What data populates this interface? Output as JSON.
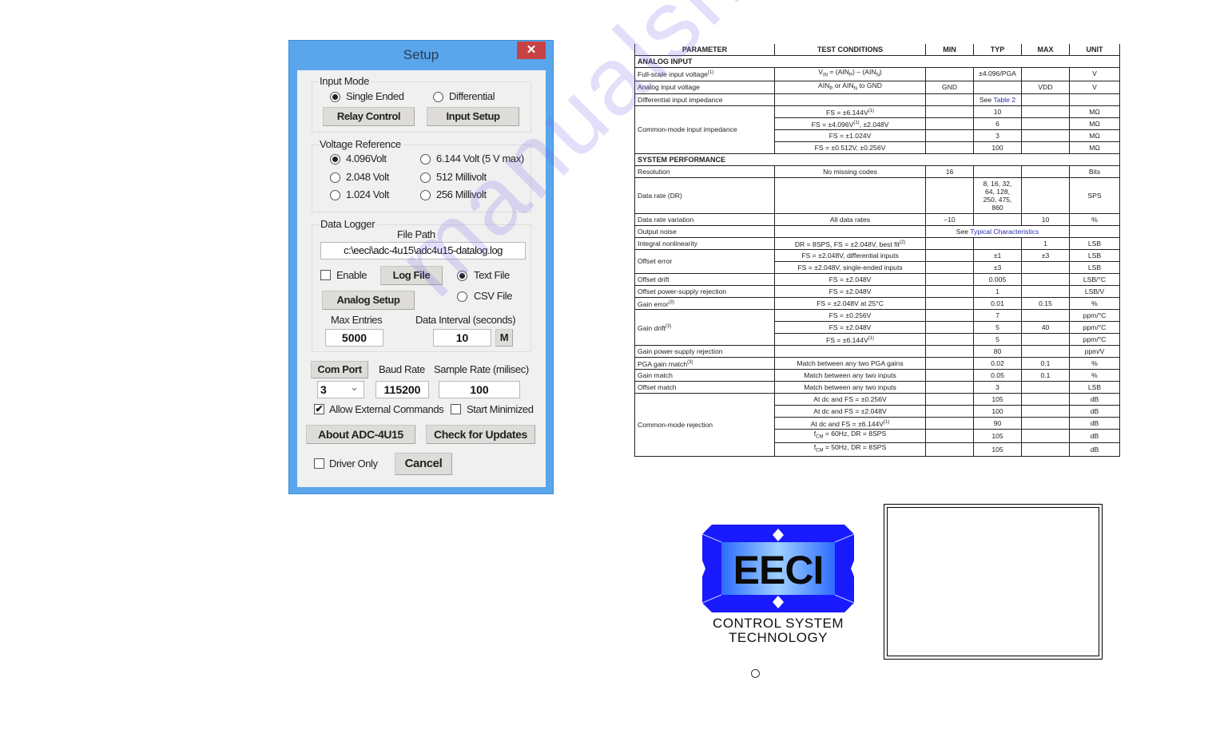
{
  "dialog": {
    "title": "Setup",
    "close_glyph": "✕",
    "input_mode": {
      "label": "Input Mode",
      "options": [
        {
          "label": "Single Ended",
          "selected": true
        },
        {
          "label": "Differential",
          "selected": false
        }
      ],
      "relay_button": "Relay Control",
      "input_setup_button": "Input Setup"
    },
    "voltage_reference": {
      "label": "Voltage Reference",
      "options": [
        {
          "label": "4.096Volt",
          "selected": true
        },
        {
          "label": "6.144 Volt (5 V max)",
          "selected": false
        },
        {
          "label": "2.048 Volt",
          "selected": false
        },
        {
          "label": "512 Millivolt",
          "selected": false
        },
        {
          "label": "1.024 Volt",
          "selected": false
        },
        {
          "label": "256 Millivolt",
          "selected": false
        }
      ]
    },
    "data_logger": {
      "label": "Data Logger",
      "file_path_label": "File Path",
      "file_path": "c:\\eeci\\adc-4u15\\adc4u15-datalog.log",
      "enable_label": "Enable",
      "enable_checked": false,
      "log_file_button": "Log File",
      "text_file_label": "Text File",
      "text_file_selected": true,
      "csv_file_label": "CSV File",
      "csv_file_selected": false,
      "analog_setup_button": "Analog Setup",
      "max_entries_label": "Max Entries",
      "max_entries": "5000",
      "data_interval_label": "Data Interval (seconds)",
      "data_interval": "10",
      "m_button": "M"
    },
    "com_port_button": "Com Port",
    "com_port_value": "3",
    "baud_rate_label": "Baud Rate",
    "baud_rate": "115200",
    "sample_rate_label": "Sample Rate (milisec)",
    "sample_rate": "100",
    "allow_external_label": "Allow External Commands",
    "allow_external_checked": true,
    "start_minimized_label": "Start Minimized",
    "start_minimized_checked": false,
    "about_button": "About ADC-4U15",
    "updates_button": "Check for Updates",
    "driver_only_label": "Driver Only",
    "driver_only_checked": false,
    "cancel_button": "Cancel",
    "check_glyph": "✔",
    "dropdown_glyph": "⌄"
  },
  "spec_table": {
    "headers": [
      "PARAMETER",
      "TEST CONDITIONS",
      "MIN",
      "TYP",
      "MAX",
      "UNIT"
    ],
    "sections": {
      "analog_input": "ANALOG INPUT",
      "system_performance": "SYSTEM PERFORMANCE"
    },
    "rows": {
      "fs_input": {
        "param": "Full-scale input voltage",
        "sup": "(1)",
        "cond": "V<sub>IN</sub> = (AIN<sub>P</sub>) – (AIN<sub>N</sub>)",
        "typ": "±4.096/PGA",
        "unit": "V"
      },
      "analog_input_v": {
        "param": "Analog input voltage",
        "cond": "AIN<sub>P</sub> or AIN<sub>N</sub> to GND",
        "min": "GND",
        "max": "VDD",
        "unit": "V"
      },
      "diff_imp": {
        "param": "Differential input impedance",
        "typ_prefix": "See ",
        "typ_link": "Table 2"
      },
      "cm_imp": {
        "param": "Common-mode input impedance",
        "subrows": [
          {
            "cond": "FS = ±6.144V<sup>(1)</sup>",
            "typ": "10",
            "unit": "MΩ"
          },
          {
            "cond": "FS = ±4.096V<sup>(1)</sup>, ±2.048V",
            "typ": "6",
            "unit": "MΩ"
          },
          {
            "cond": "FS = ±1.024V",
            "typ": "3",
            "unit": "MΩ"
          },
          {
            "cond": "FS = ±0.512V, ±0.256V",
            "typ": "100",
            "unit": "MΩ"
          }
        ]
      },
      "resolution": {
        "param": "Resolution",
        "cond": "No missing codes",
        "min": "16",
        "unit": "Bits"
      },
      "data_rate": {
        "param": "Data rate (DR)",
        "typ": "8, 16, 32, 64, 128, 250, 475, 860",
        "unit": "SPS"
      },
      "dr_variation": {
        "param": "Data rate variation",
        "cond": "All data rates",
        "min": "–10",
        "max": "10",
        "unit": "%"
      },
      "output_noise": {
        "param": "Output noise",
        "span_prefix": "See ",
        "span_link": "Typical Characteristics"
      },
      "inl": {
        "param": "Integral nonlinearity",
        "cond": "DR = 8SPS, FS = ±2.048V, best fit<sup>(2)</sup>",
        "max": "1",
        "unit": "LSB"
      },
      "offset_error": {
        "param": "Offset error",
        "subrows": [
          {
            "cond": "FS = ±2.048V, differential inputs",
            "typ": "±1",
            "max": "±3",
            "unit": "LSB"
          },
          {
            "cond": "FS = ±2.048V, single-ended inputs",
            "typ": "±3",
            "max": "",
            "unit": "LSB"
          }
        ]
      },
      "offset_drift": {
        "param": "Offset drift",
        "cond": "FS = ±2.048V",
        "typ": "0.005",
        "unit": "LSB/°C"
      },
      "offset_psr": {
        "param": "Offset power-supply rejection",
        "cond": "FS = ±2.048V",
        "typ": "1",
        "unit": "LSB/V"
      },
      "gain_error": {
        "param": "Gain error",
        "sup": "(3)",
        "cond": "FS = ±2.048V at 25°C",
        "typ": "0.01",
        "max": "0.15",
        "unit": "%"
      },
      "gain_drift": {
        "param": "Gain drift",
        "sup": "(3)",
        "subrows": [
          {
            "cond": "FS = ±0.256V",
            "typ": "7",
            "max": "",
            "unit": "ppm/°C"
          },
          {
            "cond": "FS = ±2.048V",
            "typ": "5",
            "max": "40",
            "unit": "ppm/°C"
          },
          {
            "cond": "FS = ±6.144V<sup>(1)</sup>",
            "typ": "5",
            "max": "",
            "unit": "ppm/°C"
          }
        ]
      },
      "gain_psr": {
        "param": "Gain power-supply rejection",
        "typ": "80",
        "unit": "ppm/V"
      },
      "pga_match": {
        "param": "PGA gain match",
        "sup": "(3)",
        "cond": "Match between any two PGA gains",
        "typ": "0.02",
        "max": "0.1",
        "unit": "%"
      },
      "gain_match": {
        "param": "Gain match",
        "cond": "Match between any two inputs",
        "typ": "0.05",
        "max": "0.1",
        "unit": "%"
      },
      "offset_match": {
        "param": "Offset match",
        "cond": "Match between any two inputs",
        "typ": "3",
        "unit": "LSB"
      },
      "cmr": {
        "param": "Common-mode rejection",
        "subrows": [
          {
            "cond": "At dc and FS = ±0.256V",
            "typ": "105",
            "unit": "dB"
          },
          {
            "cond": "At dc and FS = ±2.048V",
            "typ": "100",
            "unit": "dB"
          },
          {
            "cond": "At dc and FS = ±6.144V<sup>(1)</sup>",
            "typ": "90",
            "unit": "dB"
          },
          {
            "cond": "f<sub>CM</sub> = 60Hz, DR = 8SPS",
            "typ": "105",
            "unit": "dB"
          },
          {
            "cond": "f<sub>CM</sub> = 50Hz, DR = 8SPS",
            "typ": "105",
            "unit": "dB"
          }
        ]
      }
    }
  },
  "logo": {
    "mark": "EECI",
    "line1": "CONTROL SYSTEM",
    "line2": "TECHNOLOGY",
    "colors": {
      "outer": "#1a1aff",
      "inner": "#3d8bff",
      "text": "#0a0a0a"
    }
  },
  "watermark": "manualshive.com"
}
